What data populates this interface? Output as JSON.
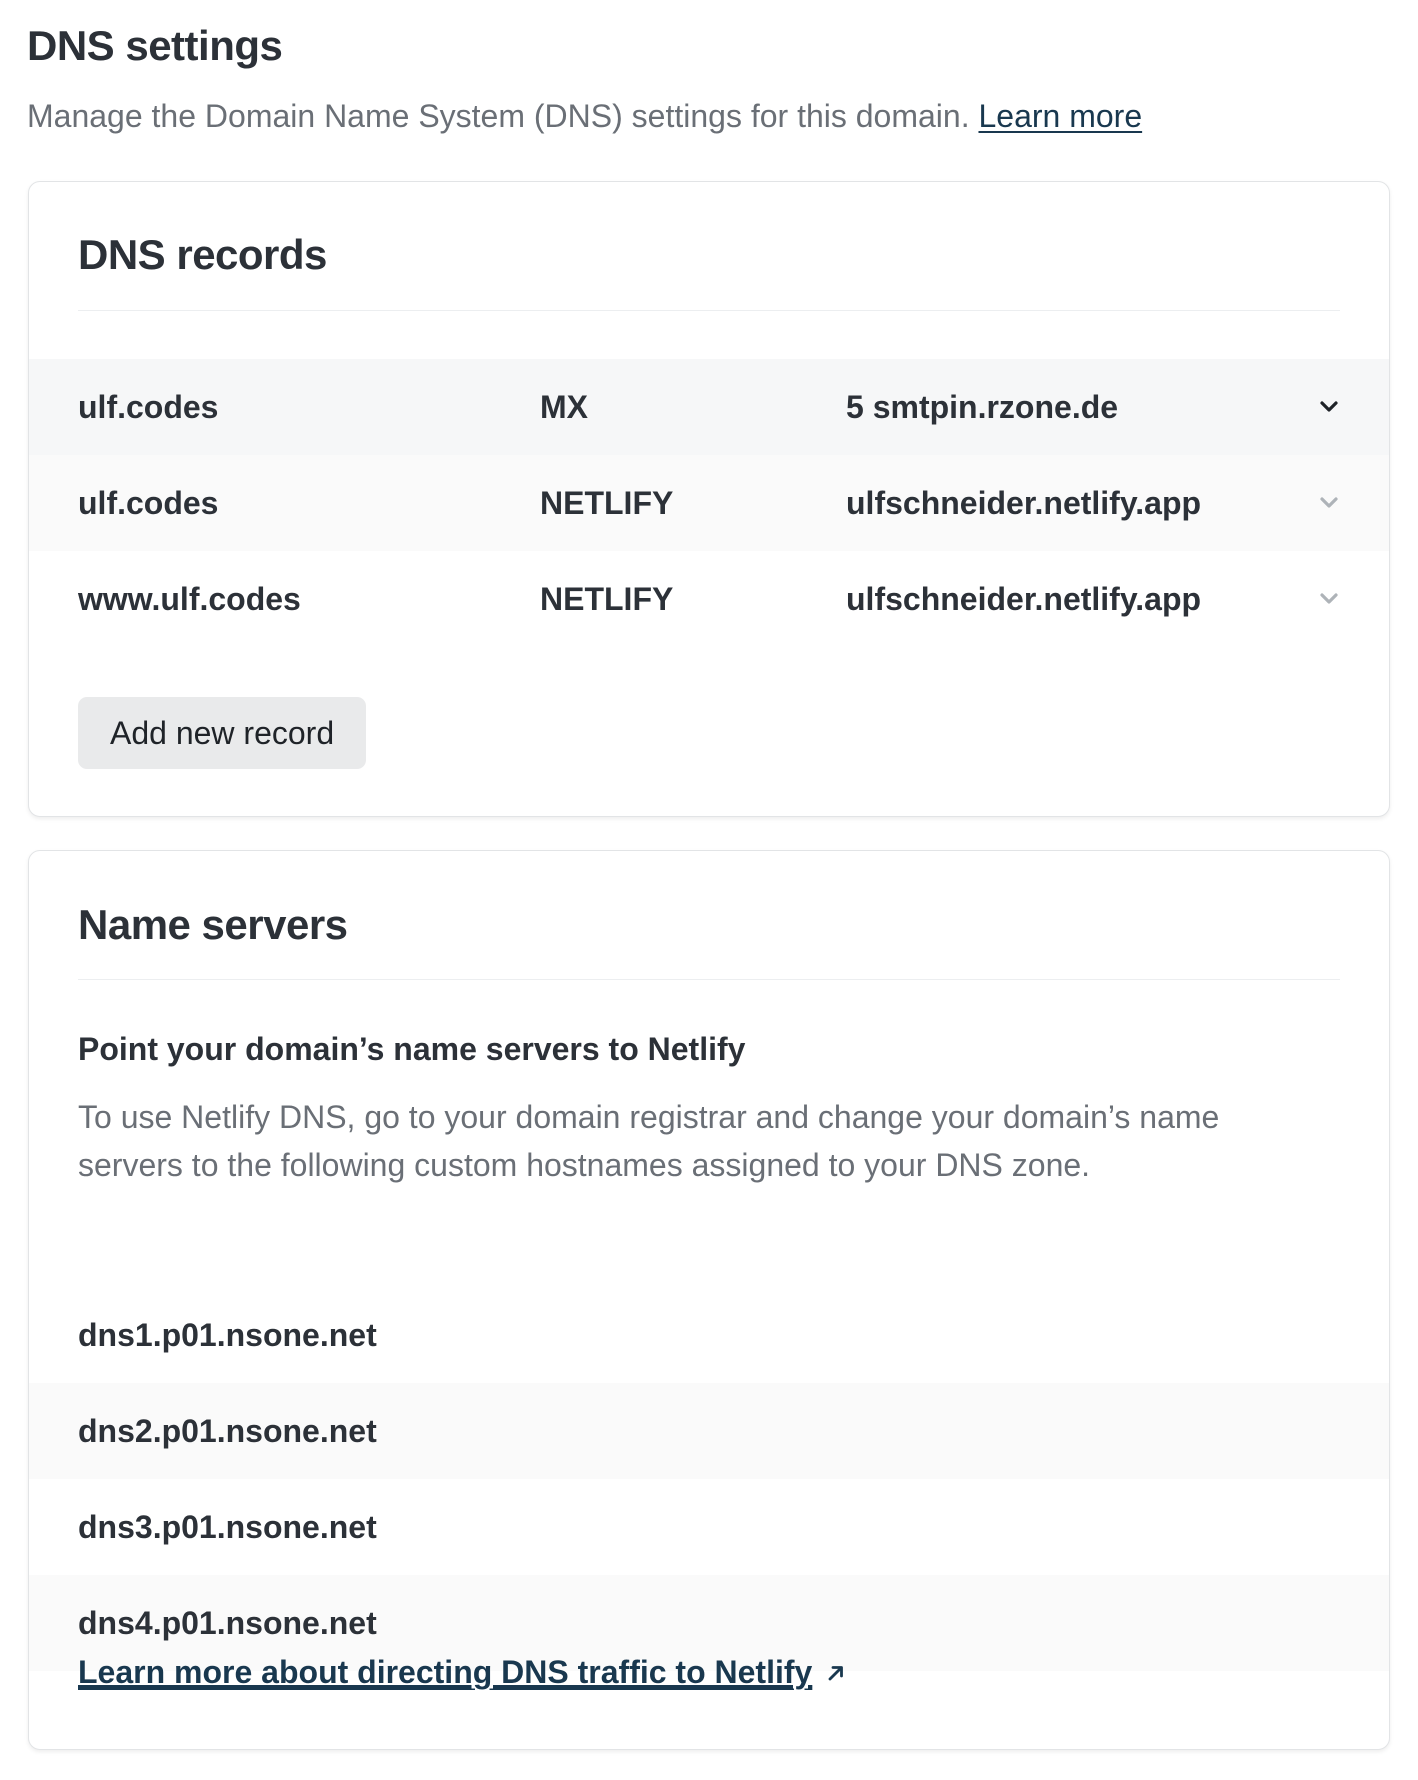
{
  "header": {
    "title": "DNS settings",
    "description": "Manage the Domain Name System (DNS) settings for this domain.",
    "learn_more": "Learn more"
  },
  "records": {
    "title": "DNS records",
    "rows": [
      {
        "name": "ulf.codes",
        "type": "MX",
        "value": "5 smtpin.rzone.de"
      },
      {
        "name": "ulf.codes",
        "type": "NETLIFY",
        "value": "ulfschneider.netlify.app"
      },
      {
        "name": "www.ulf.codes",
        "type": "NETLIFY",
        "value": "ulfschneider.netlify.app"
      }
    ],
    "add_button": "Add new record"
  },
  "name_servers": {
    "title": "Name servers",
    "subtitle": "Point your domain’s name servers to Netlify",
    "description": "To use Netlify DNS, go to your domain registrar and change your domain’s name servers to the following custom hostnames assigned to your DNS zone.",
    "servers": [
      "dns1.p01.nsone.net",
      "dns2.p01.nsone.net",
      "dns3.p01.nsone.net",
      "dns4.p01.nsone.net"
    ],
    "learn_link": "Learn more about directing DNS traffic to Netlify"
  },
  "icons": {
    "row_expand": "chevron-down-icon",
    "external_link": "arrow-up-right-icon"
  },
  "colors": {
    "link": "#19384f",
    "text": "#2c3138",
    "muted": "#6a6f76"
  }
}
